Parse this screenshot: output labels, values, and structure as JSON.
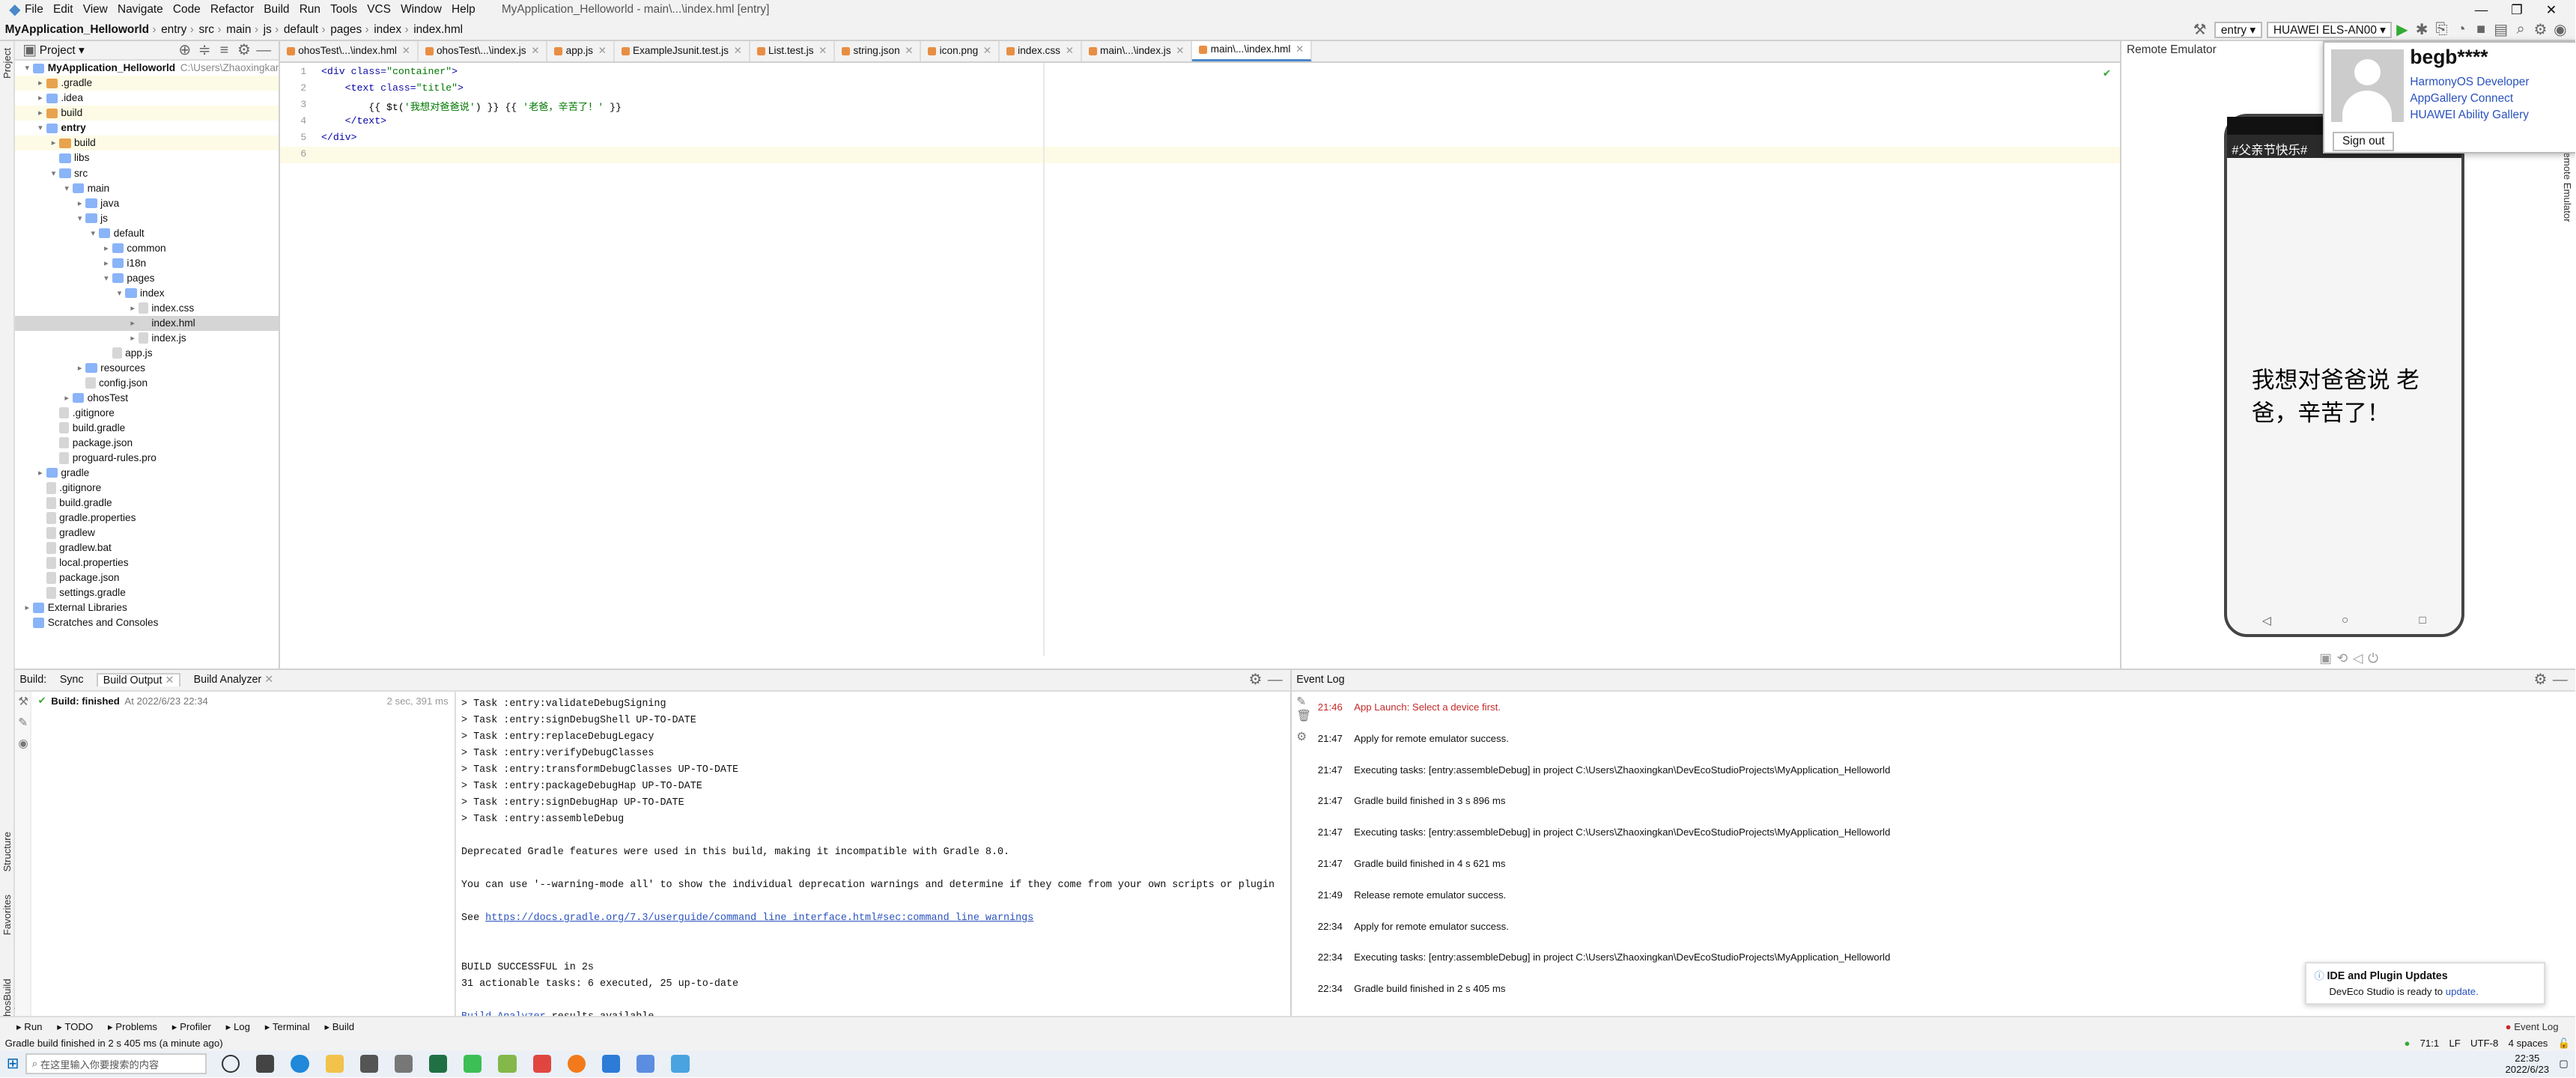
{
  "menubar": {
    "items": [
      "File",
      "Edit",
      "View",
      "Navigate",
      "Code",
      "Refactor",
      "Build",
      "Run",
      "Tools",
      "VCS",
      "Window",
      "Help"
    ],
    "title": "MyApplication_Helloworld - main\\...\\index.hml [entry]"
  },
  "navbar": {
    "crumbs": [
      "MyApplication_Helloworld",
      "entry",
      "src",
      "main",
      "js",
      "default",
      "pages",
      "index",
      "index.hml"
    ],
    "run_config": "entry",
    "device": "HUAWEI ELS-AN00"
  },
  "project": {
    "title": "Project",
    "root_path": "C:\\Users\\Zhaoxingkan\\D"
  },
  "tree": [
    {
      "d": 0,
      "n": "MyApplication_Helloworld",
      "t": "root",
      "o": 1
    },
    {
      "d": 1,
      "n": ".gradle",
      "t": "fx",
      "hl": 1
    },
    {
      "d": 1,
      "n": ".idea",
      "t": "f"
    },
    {
      "d": 1,
      "n": "build",
      "t": "fx",
      "hl": 1
    },
    {
      "d": 1,
      "n": "entry",
      "t": "f",
      "o": 1,
      "b": 1
    },
    {
      "d": 2,
      "n": "build",
      "t": "fx",
      "hl": 1
    },
    {
      "d": 2,
      "n": "libs",
      "t": "f",
      "nc": 1
    },
    {
      "d": 2,
      "n": "src",
      "t": "f",
      "o": 1
    },
    {
      "d": 3,
      "n": "main",
      "t": "f",
      "o": 1
    },
    {
      "d": 4,
      "n": "java",
      "t": "f"
    },
    {
      "d": 4,
      "n": "js",
      "t": "f",
      "o": 1
    },
    {
      "d": 5,
      "n": "default",
      "t": "f",
      "o": 1
    },
    {
      "d": 6,
      "n": "common",
      "t": "f"
    },
    {
      "d": 6,
      "n": "i18n",
      "t": "f"
    },
    {
      "d": 6,
      "n": "pages",
      "t": "f",
      "o": 1
    },
    {
      "d": 7,
      "n": "index",
      "t": "f",
      "o": 1
    },
    {
      "d": 8,
      "n": "index.css",
      "t": "file"
    },
    {
      "d": 8,
      "n": "index.hml",
      "t": "file",
      "s": 1
    },
    {
      "d": 8,
      "n": "index.js",
      "t": "file"
    },
    {
      "d": 6,
      "n": "app.js",
      "t": "file",
      "nc": 1
    },
    {
      "d": 4,
      "n": "resources",
      "t": "f"
    },
    {
      "d": 4,
      "n": "config.json",
      "t": "file",
      "nc": 1
    },
    {
      "d": 3,
      "n": "ohosTest",
      "t": "f"
    },
    {
      "d": 2,
      "n": ".gitignore",
      "t": "file",
      "nc": 1
    },
    {
      "d": 2,
      "n": "build.gradle",
      "t": "file",
      "nc": 1
    },
    {
      "d": 2,
      "n": "package.json",
      "t": "file",
      "nc": 1
    },
    {
      "d": 2,
      "n": "proguard-rules.pro",
      "t": "file",
      "nc": 1
    },
    {
      "d": 1,
      "n": "gradle",
      "t": "f"
    },
    {
      "d": 1,
      "n": ".gitignore",
      "t": "file",
      "nc": 1
    },
    {
      "d": 1,
      "n": "build.gradle",
      "t": "file",
      "nc": 1
    },
    {
      "d": 1,
      "n": "gradle.properties",
      "t": "file",
      "nc": 1
    },
    {
      "d": 1,
      "n": "gradlew",
      "t": "file",
      "nc": 1
    },
    {
      "d": 1,
      "n": "gradlew.bat",
      "t": "file",
      "nc": 1
    },
    {
      "d": 1,
      "n": "local.properties",
      "t": "file",
      "nc": 1
    },
    {
      "d": 1,
      "n": "package.json",
      "t": "file",
      "nc": 1
    },
    {
      "d": 1,
      "n": "settings.gradle",
      "t": "file",
      "nc": 1
    },
    {
      "d": 0,
      "n": "External Libraries",
      "t": "f"
    },
    {
      "d": 0,
      "n": "Scratches and Consoles",
      "t": "f",
      "nc": 1
    }
  ],
  "tabs": [
    "ohosTest\\...\\index.hml",
    "ohosTest\\...\\index.js",
    "app.js",
    "ExampleJsunit.test.js",
    "List.test.js",
    "string.json",
    "icon.png",
    "index.css",
    "main\\...\\index.js",
    "main\\...\\index.hml"
  ],
  "active_tab": 9,
  "code": [
    [
      [
        "tg",
        "<div "
      ],
      [
        "at",
        "class="
      ],
      [
        "st",
        "\"container\""
      ],
      [
        "tg",
        ">"
      ]
    ],
    [
      [
        "tg",
        "    <text "
      ],
      [
        "at",
        "class="
      ],
      [
        "st",
        "\"title\""
      ],
      [
        "tg",
        ">"
      ]
    ],
    [
      [
        "br",
        "        {{ $t("
      ],
      [
        "st",
        "'我想对爸爸说'"
      ],
      [
        "br",
        ") }} {{ "
      ],
      [
        "st",
        "'老爸，辛苦了！'"
      ],
      [
        "br",
        " }}"
      ]
    ],
    [
      [
        "tg",
        "    </text>"
      ]
    ],
    [
      [
        "tg",
        "</div>"
      ]
    ],
    [
      [
        "br",
        ""
      ]
    ]
  ],
  "emulator": {
    "title": "Remote Emulator",
    "banner": "#父亲节快乐#",
    "message": "我想对爸爸说 老爸，辛苦了！"
  },
  "account": {
    "name": "begb****",
    "links": [
      "HarmonyOS Developer",
      "AppGallery Connect",
      "HUAWEI Ability Gallery"
    ],
    "signout": "Sign out"
  },
  "build": {
    "tabs": [
      "Build:",
      "Sync",
      "Build Output",
      "Build Analyzer"
    ],
    "status": "Build: finished",
    "status_time": "At 2022/6/23 22:34",
    "duration": "2 sec, 391 ms",
    "output": [
      "> Task :entry:validateDebugSigning",
      "> Task :entry:signDebugShell UP-TO-DATE",
      "> Task :entry:replaceDebugLegacy",
      "> Task :entry:verifyDebugClasses",
      "> Task :entry:transformDebugClasses UP-TO-DATE",
      "> Task :entry:packageDebugHap UP-TO-DATE",
      "> Task :entry:signDebugHap UP-TO-DATE",
      "> Task :entry:assembleDebug",
      "",
      "Deprecated Gradle features were used in this build, making it incompatible with Gradle 8.0.",
      "",
      "You can use '--warning-mode all' to show the individual deprecation warnings and determine if they come from your own scripts or plugin",
      "",
      ""
    ],
    "see_prefix": "See ",
    "see_link": "https://docs.gradle.org/7.3/userguide/command_line_interface.html#sec:command_line_warnings",
    "output2": [
      "",
      "BUILD SUCCESSFUL in 2s",
      "31 actionable tasks: 6 executed, 25 up-to-date",
      ""
    ],
    "analyzer_link": "Build Analyzer",
    "analyzer_suffix": " results available"
  },
  "events": {
    "title": "Event Log",
    "items": [
      {
        "t": "21:46",
        "m": "App Launch: Select a device first.",
        "e": 1
      },
      {
        "t": "21:47",
        "m": "Apply for remote emulator success."
      },
      {
        "t": "21:47",
        "m": "Executing tasks: [entry:assembleDebug] in project C:\\Users\\Zhaoxingkan\\DevEcoStudioProjects\\MyApplication_Helloworld"
      },
      {
        "t": "21:47",
        "m": "Gradle build finished in 3 s 896 ms"
      },
      {
        "t": "21:47",
        "m": "Executing tasks: [entry:assembleDebug] in project C:\\Users\\Zhaoxingkan\\DevEcoStudioProjects\\MyApplication_Helloworld"
      },
      {
        "t": "21:47",
        "m": "Gradle build finished in 4 s 621 ms"
      },
      {
        "t": "21:49",
        "m": "Release remote emulator success."
      },
      {
        "t": "22:34",
        "m": "Apply for remote emulator success."
      },
      {
        "t": "22:34",
        "m": "Executing tasks: [entry:assembleDebug] in project C:\\Users\\Zhaoxingkan\\DevEcoStudioProjects\\MyApplication_Helloworld"
      },
      {
        "t": "22:34",
        "m": "Gradle build finished in 2 s 405 ms"
      }
    ]
  },
  "updates": {
    "title": "IDE and Plugin Updates",
    "text": "DevEco Studio is ready to ",
    "link": "update."
  },
  "toolwindows": [
    "Run",
    "TODO",
    "Problems",
    "Profiler",
    "Log",
    "Terminal",
    "Build"
  ],
  "event_log_btn": "Event Log",
  "leftstrip": [
    "Project",
    "Structure",
    "Favorites",
    "OhosBuild Variants"
  ],
  "rightstrip": "Remote Emulator",
  "status": {
    "message": "Gradle build finished in 2 s 405 ms (a minute ago)",
    "pos": "71:1",
    "lf": "LF",
    "enc": "UTF-8",
    "indent": "4 spaces"
  },
  "taskbar": {
    "search": "在这里输入你要搜索的内容",
    "time": "22:35",
    "date": "2022/6/23"
  },
  "colors": {
    "accent": "#4a88c7",
    "error": "#c62828",
    "link": "#2a52be"
  }
}
